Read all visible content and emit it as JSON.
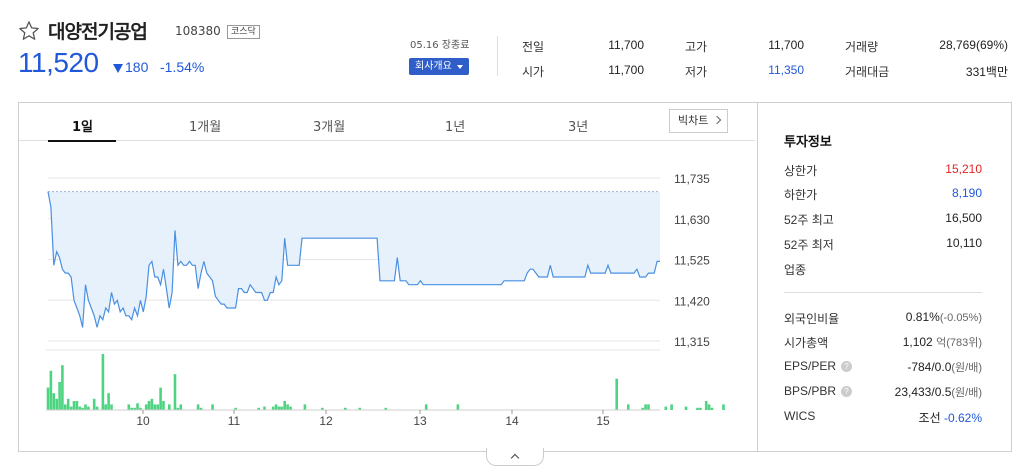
{
  "stock": {
    "name": "대양전기공업",
    "code": "108380",
    "market": "코스닥",
    "price": "11,520",
    "change": "180",
    "rate": "-1.54%",
    "direction": "down"
  },
  "market_time": "05.16 장종료",
  "company_button": "회사개요",
  "quote": {
    "prev_label": "전일",
    "prev": "11,700",
    "high_label": "고가",
    "high": "11,700",
    "volume_label": "거래량",
    "volume": "28,769(69%)",
    "open_label": "시가",
    "open": "11,700",
    "low_label": "저가",
    "low": "11,350",
    "amount_label": "거래대금",
    "amount": "331백만"
  },
  "tabs": [
    {
      "label": "1일",
      "active": true
    },
    {
      "label": "1개월",
      "active": false
    },
    {
      "label": "3개월",
      "active": false
    },
    {
      "label": "1년",
      "active": false
    },
    {
      "label": "3년",
      "active": false
    }
  ],
  "big_chart_button": "빅차트",
  "info": {
    "title": "투자정보",
    "upper_label": "상한가",
    "upper": "15,210",
    "lower_label": "하한가",
    "lower": "8,190",
    "high52_label": "52주 최고",
    "high52": "16,500",
    "low52_label": "52주 최저",
    "low52": "10,110",
    "sector_label": "업종",
    "foreign_label": "외국인비율",
    "foreign": "0.81%",
    "foreign_sub": "(-0.05%)",
    "mcap_label": "시가총액",
    "mcap": "1,102",
    "mcap_sub": "억(783위)",
    "eps_label": "EPS/PER",
    "eps": "-784/0.0",
    "eps_sub": "(원/배)",
    "bps_label": "BPS/PBR",
    "bps": "23,433/0.5",
    "bps_sub": "(원/배)",
    "wics_label": "WICS",
    "wics": "조선",
    "wics_rate": "-0.62%"
  },
  "colors": {
    "down": "#2158d9",
    "up": "#e02424",
    "line": "#4a90e2",
    "fill": "#e3effc",
    "volume": "#4cd480"
  },
  "chart_data": {
    "type": "area",
    "y_ticks": [
      "11,735",
      "11,630",
      "11,525",
      "11,420",
      "11,315"
    ],
    "x_ticks": [
      "10",
      "11",
      "12",
      "13",
      "14",
      "15"
    ],
    "ylim": [
      11315,
      11735
    ],
    "reference": 11700,
    "price": [
      11700,
      11660,
      11510,
      11545,
      11530,
      11500,
      11490,
      11490,
      11480,
      11420,
      11400,
      11380,
      11350,
      11460,
      11420,
      11400,
      11380,
      11350,
      11380,
      11370,
      11400,
      11390,
      11440,
      11410,
      11420,
      11390,
      11400,
      11380,
      11380,
      11370,
      11400,
      11380,
      11420,
      11390,
      11430,
      11510,
      11520,
      11480,
      11480,
      11460,
      11500,
      11450,
      11400,
      11440,
      11600,
      11510,
      11520,
      11510,
      11510,
      11520,
      11510,
      11510,
      11450,
      11490,
      11520,
      11490,
      11480,
      11470,
      11430,
      11420,
      11410,
      11410,
      11400,
      11400,
      11400,
      11400,
      11450,
      11450,
      11440,
      11440,
      11460,
      11450,
      11440,
      11440,
      11440,
      11420,
      11420,
      11440,
      11440,
      11480,
      11460,
      11470,
      11580,
      11510,
      11510,
      11510,
      11510,
      11510,
      11580,
      11580,
      11580,
      11580,
      11580,
      11580,
      11580,
      11580,
      11580,
      11580,
      11580,
      11580,
      11580,
      11580,
      11580,
      11580,
      11580,
      11580,
      11580,
      11580,
      11580,
      11580,
      11580,
      11580,
      11580,
      11580,
      11580,
      11470,
      11470,
      11470,
      11470,
      11470,
      11470,
      11530,
      11470,
      11470,
      11470,
      11460,
      11460,
      11460,
      11460,
      11470,
      11460,
      11460,
      11460,
      11460,
      11460,
      11460,
      11460,
      11460,
      11460,
      11460,
      11460,
      11460,
      11460,
      11460,
      11460,
      11460,
      11460,
      11460,
      11460,
      11460,
      11460,
      11460,
      11460,
      11460,
      11460,
      11460,
      11460,
      11460,
      11470,
      11470,
      11470,
      11470,
      11470,
      11470,
      11470,
      11470,
      11490,
      11500,
      11500,
      11490,
      11480,
      11480,
      11480,
      11480,
      11510,
      11480,
      11480,
      11480,
      11480,
      11480,
      11480,
      11480,
      11480,
      11480,
      11480,
      11480,
      11480,
      11510,
      11490,
      11490,
      11490,
      11490,
      11490,
      11490,
      11510,
      11490,
      11490,
      11490,
      11490,
      11490,
      11490,
      11490,
      11490,
      11490,
      11500,
      11480,
      11480,
      11480,
      11490,
      11490,
      11490,
      11520,
      11520
    ],
    "volume": [
      2,
      3.5,
      1.5,
      1,
      2.5,
      4,
      0.5,
      1,
      0.3,
      0.8,
      0.8,
      0.3,
      0.2,
      0.5,
      0.3,
      0,
      1,
      0.3,
      0,
      5,
      0.5,
      1.5,
      0.5,
      0,
      0,
      0,
      0,
      0,
      0.5,
      0.2,
      0.2,
      0.6,
      0.2,
      0,
      0.5,
      0.8,
      1,
      0.5,
      0.5,
      2,
      0.8,
      0,
      0.5,
      0,
      3.2,
      0.2,
      0.5,
      0,
      0,
      0,
      0,
      0,
      0.5,
      0.2,
      0,
      0,
      0,
      0.5,
      0,
      0,
      0,
      0,
      0,
      0,
      0,
      0.2,
      0,
      0,
      0,
      0,
      0,
      0,
      0,
      0.2,
      0,
      0.3,
      0,
      0,
      0.3,
      0.5,
      0.3,
      0.3,
      0.8,
      0.5,
      0.3,
      0,
      0,
      0,
      0,
      0.5,
      0,
      0,
      0,
      0,
      0,
      0.2,
      0,
      0,
      0,
      0,
      0,
      0,
      0,
      0.2,
      0,
      0,
      0,
      0,
      0.2,
      0,
      0,
      0,
      0,
      0,
      0,
      0,
      0,
      0.2,
      0,
      0,
      0,
      0,
      0,
      0,
      0,
      0,
      0,
      0,
      0,
      0,
      0,
      0.5,
      0,
      0,
      0,
      0,
      0,
      0,
      0,
      0,
      0,
      0,
      0.5,
      0,
      0,
      0,
      0,
      0,
      0,
      0,
      0,
      0,
      0,
      0,
      0,
      0,
      0,
      0,
      0,
      0,
      0,
      0,
      0,
      0,
      0,
      0,
      0,
      0,
      0,
      0,
      0,
      0,
      0,
      0,
      0,
      0,
      0,
      0,
      0,
      0,
      0,
      0,
      0,
      0,
      0,
      0,
      0,
      0,
      0,
      0,
      0,
      0,
      0,
      0,
      0,
      0,
      0,
      2.8,
      0,
      0,
      0,
      0.5,
      0,
      0,
      0,
      0,
      0.2,
      0.5,
      0.5,
      0,
      0,
      0,
      0,
      0,
      0.3,
      0,
      0.5,
      0,
      0,
      0,
      0,
      0.3,
      0,
      0,
      0,
      0.2,
      0.2,
      0,
      0.8,
      0.5,
      0.2,
      0,
      0,
      0,
      0.5
    ]
  }
}
